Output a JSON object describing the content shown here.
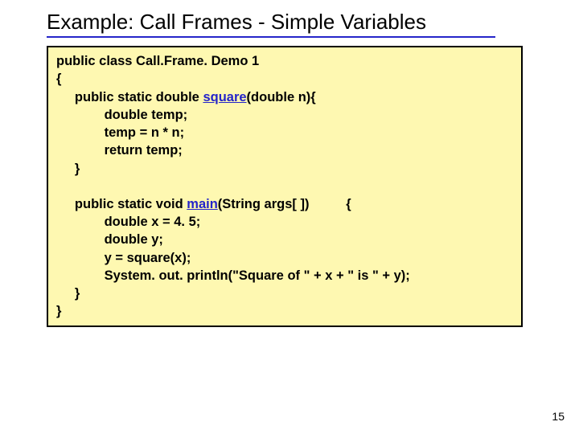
{
  "title": "Example: Call Frames - Simple Variables",
  "page_number": "15",
  "code": {
    "l1": "public class Call.Frame. Demo 1",
    "l2": "{",
    "l3a": "     public static double ",
    "l3m": "square",
    "l3b": "(double n){",
    "l4": "             double temp;",
    "l5": "             temp = n * n;",
    "l6": "             return temp;",
    "l7": "     }",
    "l8a": "     public static void ",
    "l8m": "main",
    "l8b": "(String args[ ])          {",
    "l9": "             double x = 4. 5;",
    "l10": "             double y;",
    "l11": "             y = square(x);",
    "l12": "             System. out. println(\"Square of \" + x + \" is \" + y);",
    "l13": "     }",
    "l14": "}"
  }
}
